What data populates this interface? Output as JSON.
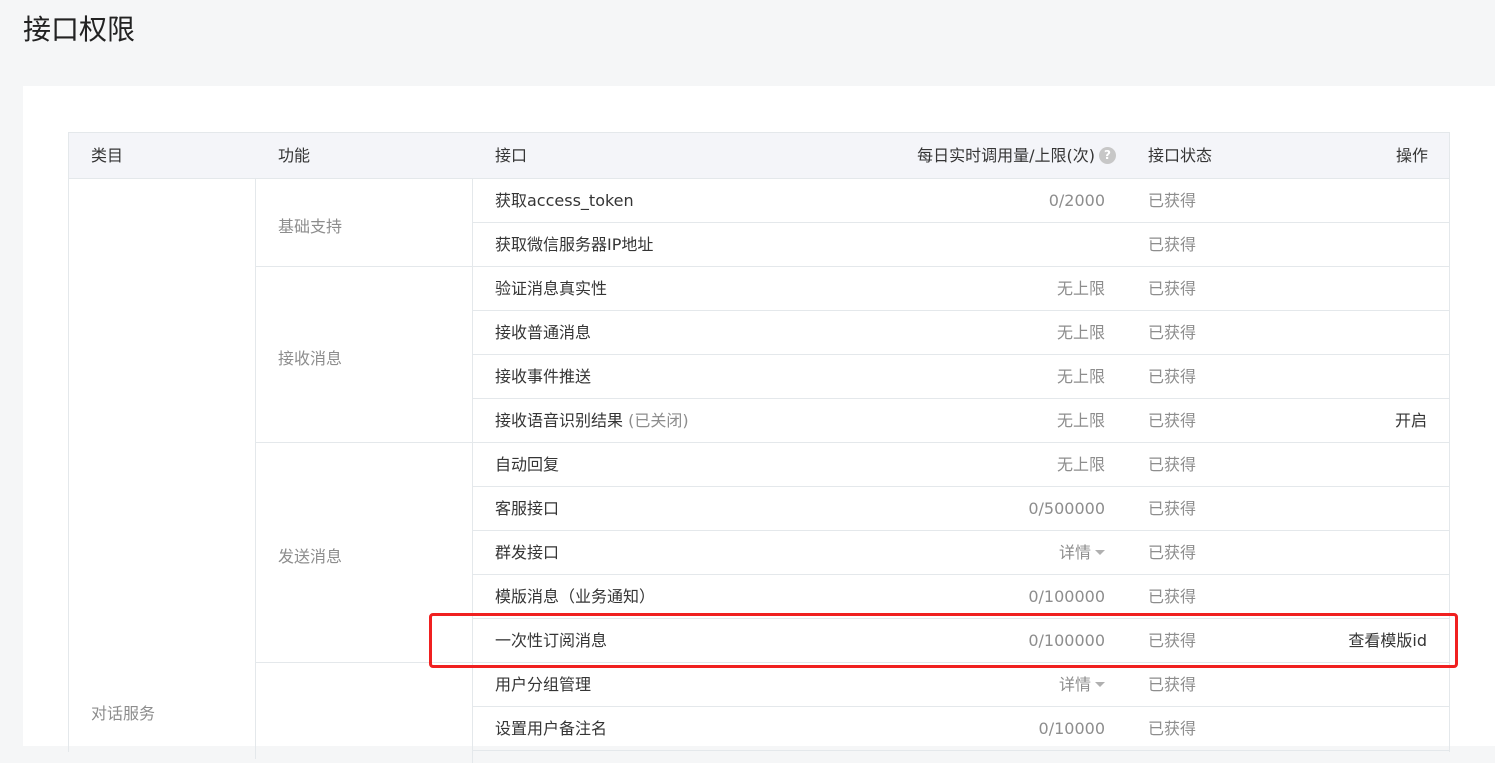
{
  "page": {
    "title": "接口权限"
  },
  "table": {
    "headers": {
      "category": "类目",
      "function": "功能",
      "interface": "接口",
      "quota": "每日实时调用量/上限(次)",
      "status": "接口状态",
      "operation": "操作"
    },
    "help_icon": "question-icon",
    "category": "对话服务",
    "functions": [
      "基础支持",
      "接收消息",
      "发送消息",
      ""
    ],
    "rows": [
      {
        "name": "获取access_token",
        "note": "",
        "quota": "0/2000",
        "has_dropdown": false,
        "status": "已获得",
        "action": ""
      },
      {
        "name": "获取微信服务器IP地址",
        "note": "",
        "quota": "",
        "has_dropdown": false,
        "status": "已获得",
        "action": ""
      },
      {
        "name": "验证消息真实性",
        "note": "",
        "quota": "无上限",
        "has_dropdown": false,
        "status": "已获得",
        "action": ""
      },
      {
        "name": "接收普通消息",
        "note": "",
        "quota": "无上限",
        "has_dropdown": false,
        "status": "已获得",
        "action": ""
      },
      {
        "name": "接收事件推送",
        "note": "",
        "quota": "无上限",
        "has_dropdown": false,
        "status": "已获得",
        "action": ""
      },
      {
        "name": "接收语音识别结果",
        "note": " (已关闭)",
        "quota": "无上限",
        "has_dropdown": false,
        "status": "已获得",
        "action": "开启"
      },
      {
        "name": "自动回复",
        "note": "",
        "quota": "无上限",
        "has_dropdown": false,
        "status": "已获得",
        "action": ""
      },
      {
        "name": "客服接口",
        "note": "",
        "quota": "0/500000",
        "has_dropdown": false,
        "status": "已获得",
        "action": ""
      },
      {
        "name": "群发接口",
        "note": "",
        "quota": "详情",
        "has_dropdown": true,
        "status": "已获得",
        "action": ""
      },
      {
        "name": "模版消息（业务通知）",
        "note": "",
        "quota": "0/100000",
        "has_dropdown": false,
        "status": "已获得",
        "action": ""
      },
      {
        "name": "一次性订阅消息",
        "note": "",
        "quota": "0/100000",
        "has_dropdown": false,
        "status": "已获得",
        "action": "查看模版id"
      },
      {
        "name": "用户分组管理",
        "note": "",
        "quota": "详情",
        "has_dropdown": true,
        "status": "已获得",
        "action": ""
      },
      {
        "name": "设置用户备注名",
        "note": "",
        "quota": "0/10000",
        "has_dropdown": false,
        "status": "已获得",
        "action": ""
      }
    ]
  },
  "highlight": {
    "color": "#f02020",
    "target_row": "一次性订阅消息"
  }
}
